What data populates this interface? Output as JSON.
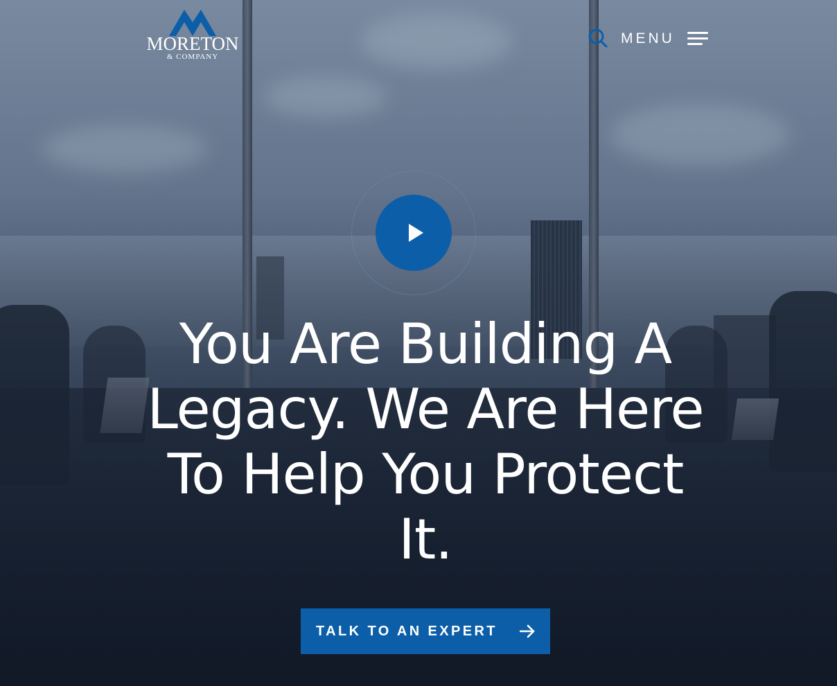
{
  "brand": {
    "name": "MORETON",
    "subtitle": "& COMPANY",
    "logo_icon": "mountain-peaks-icon",
    "accent_color": "#0c5ea8"
  },
  "header": {
    "search_icon": "search-icon",
    "menu_label": "MENU",
    "menu_icon": "hamburger-icon"
  },
  "hero": {
    "play_icon": "play-icon",
    "headline": "You Are Building A Legacy. We Are Here To Help You Protect It.",
    "cta_label": "TALK TO AN EXPERT",
    "cta_icon": "arrow-right-icon"
  }
}
